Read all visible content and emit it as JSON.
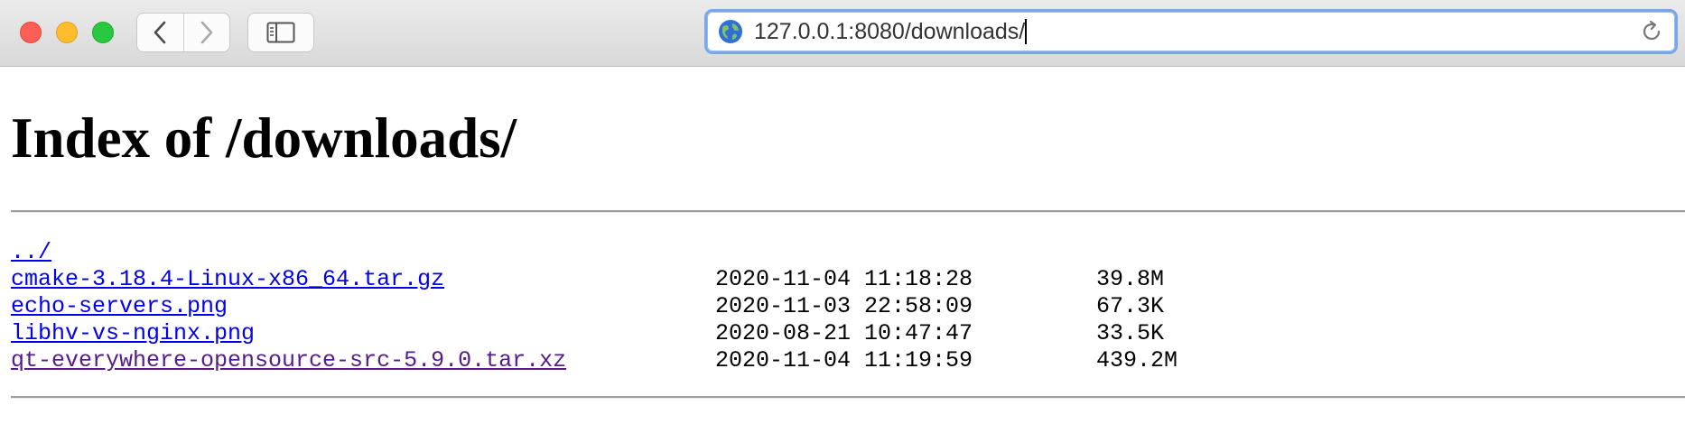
{
  "browser": {
    "url": "127.0.0.1:8080/downloads/"
  },
  "page": {
    "title": "Index of /downloads/",
    "parent_link": "../",
    "entries": [
      {
        "name": "cmake-3.18.4-Linux-x86_64.tar.gz",
        "date": "2020-11-04 11:18:28",
        "size": "39.8M",
        "visited": false
      },
      {
        "name": "echo-servers.png",
        "date": "2020-11-03 22:58:09",
        "size": "67.3K",
        "visited": false
      },
      {
        "name": "libhv-vs-nginx.png",
        "date": "2020-08-21 10:47:47",
        "size": "33.5K",
        "visited": false
      },
      {
        "name": "qt-everywhere-opensource-src-5.9.0.tar.xz",
        "date": "2020-11-04 11:19:59",
        "size": "439.2M",
        "visited": true
      }
    ]
  },
  "icons": {
    "back": "chevron-left-icon",
    "forward": "chevron-right-icon",
    "sidebar": "sidebar-icon",
    "globe": "globe-icon",
    "reload": "reload-icon"
  },
  "colors": {
    "link": "#0000ee",
    "visited_link": "#551a8b",
    "address_focus": "#7aa7e6",
    "close": "#ff5f57",
    "minimize": "#ffbd2e",
    "maximize": "#28c941"
  }
}
